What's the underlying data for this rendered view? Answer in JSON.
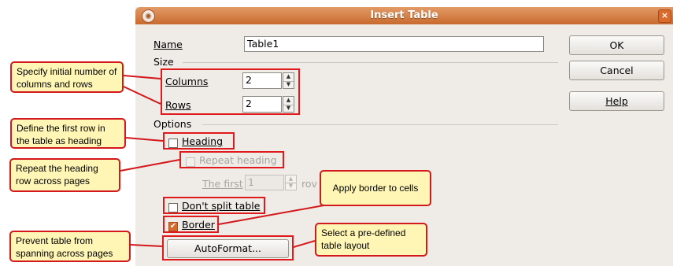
{
  "dialog": {
    "title": "Insert Table",
    "menu_icon": "◉",
    "close_icon": "×",
    "name_label": "Name",
    "name_value": "Table1",
    "size_section": "Size",
    "columns_label": "Columns",
    "columns_value": "2",
    "rows_label": "Rows",
    "rows_value": "2",
    "options_section": "Options",
    "heading_label": "Heading",
    "repeat_heading_label": "Repeat heading",
    "the_first_label": "The first",
    "the_first_value": "1",
    "rows_suffix": "rov",
    "dont_split_label": "Don't split table",
    "border_label": "Border",
    "border_checked": true,
    "autoformat_label": "AutoFormat...",
    "ok_label": "OK",
    "cancel_label": "Cancel",
    "help_label": "Help",
    "spin_up": "▲",
    "spin_down": "▼",
    "checkmark": "✔"
  },
  "callouts": {
    "columns_rows": "Specify initial number of columns and rows",
    "heading": "Define the first row in the table as heading",
    "repeat": "Repeat the heading row across pages",
    "border": "Apply border to cells",
    "split": "Prevent table from spanning across pages",
    "autoformat": "Select a pre-defined table layout"
  },
  "colors": {
    "titlebar": "#d67b3f",
    "dialog_bg": "#efebe7",
    "callout_bg": "#fff6b5",
    "highlight": "#e0191c",
    "checkbox_checked": "#d8692c"
  }
}
